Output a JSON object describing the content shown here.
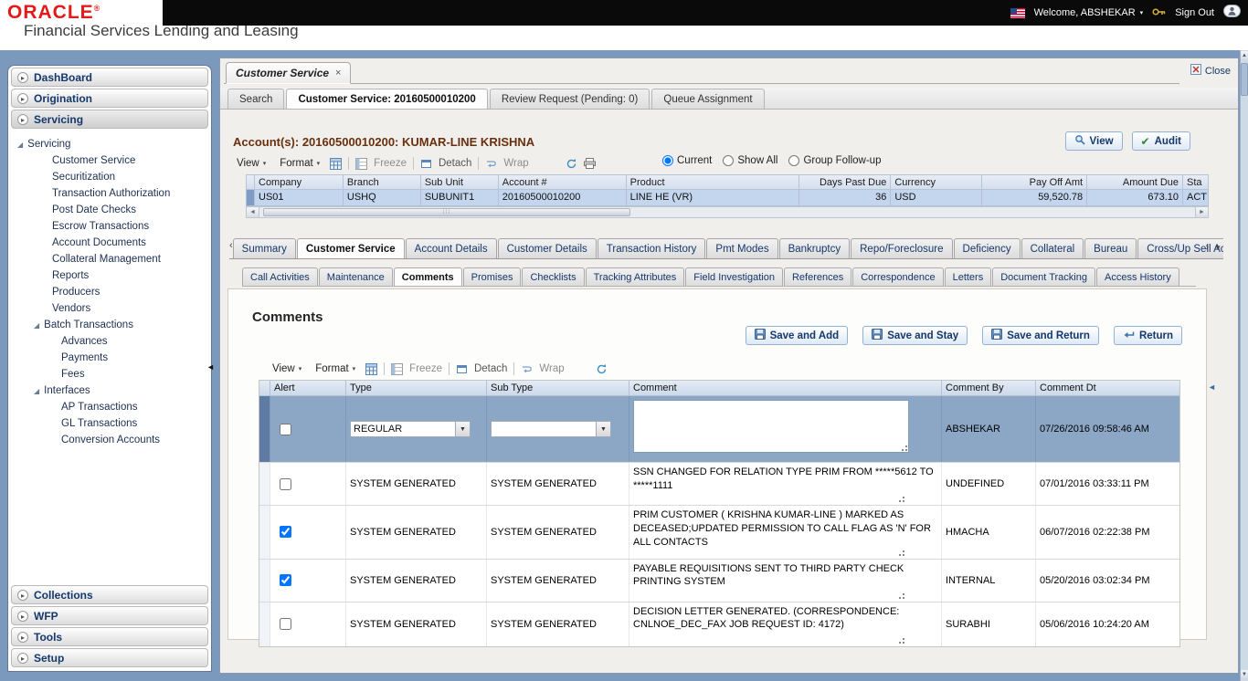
{
  "topbar": {
    "welcome": "Welcome, ABSHEKAR",
    "sign_out": "Sign Out"
  },
  "brand": {
    "logo": "ORACLE",
    "registered": "®",
    "subtitle": "Financial Services Lending and Leasing"
  },
  "sidebar": {
    "sections_top": [
      "DashBoard",
      "Origination",
      "Servicing"
    ],
    "sections_bottom": [
      "Collections",
      "WFP",
      "Tools",
      "Setup"
    ],
    "tree": {
      "root": "Servicing",
      "items": [
        "Customer Service",
        "Securitization",
        "Transaction Authorization",
        "Post Date Checks",
        "Escrow Transactions",
        "Account Documents",
        "Collateral Management",
        "Reports",
        "Producers",
        "Vendors"
      ],
      "groups": [
        {
          "label": "Batch Transactions",
          "items": [
            "Advances",
            "Payments",
            "Fees"
          ]
        },
        {
          "label": "Interfaces",
          "items": [
            "AP Transactions",
            "GL Transactions",
            "Conversion Accounts"
          ]
        }
      ]
    }
  },
  "window": {
    "doc_tab": "Customer Service",
    "close": "Close"
  },
  "nav_tabs": {
    "items": [
      "Search",
      "Customer Service: 20160500010200",
      "Review Request (Pending: 0)",
      "Queue Assignment"
    ],
    "active": "Customer Service: 20160500010200"
  },
  "account": {
    "title": "Account(s): 20160500010200: KUMAR-LINE KRISHNA",
    "buttons": {
      "view": "View",
      "audit": "Audit"
    },
    "toolbar": {
      "view": "View",
      "format": "Format",
      "freeze": "Freeze",
      "detach": "Detach",
      "wrap": "Wrap",
      "radios": [
        {
          "label": "Current",
          "checked": true
        },
        {
          "label": "Show All",
          "checked": false
        },
        {
          "label": "Group Follow-up",
          "checked": false
        }
      ]
    },
    "grid": {
      "columns": [
        "Company",
        "Branch",
        "Sub Unit",
        "Account #",
        "Product",
        "Days Past Due",
        "Currency",
        "Pay Off Amt",
        "Amount Due",
        "Sta"
      ],
      "row": {
        "company": "US01",
        "branch": "USHQ",
        "sub_unit": "SUBUNIT1",
        "account": "20160500010200",
        "product": "LINE HE (VR)",
        "days_past_due": "36",
        "currency": "USD",
        "pay_off_amt": "59,520.78",
        "amount_due": "673.10",
        "status": "ACT"
      }
    }
  },
  "section_tabs": {
    "items": [
      "Summary",
      "Customer Service",
      "Account Details",
      "Customer Details",
      "Transaction History",
      "Pmt Modes",
      "Bankruptcy",
      "Repo/Foreclosure",
      "Deficiency",
      "Collateral",
      "Bureau",
      "Cross/Up Sell Activi"
    ],
    "active": "Customer Service"
  },
  "sub_tabs": {
    "items": [
      "Call Activities",
      "Maintenance",
      "Comments",
      "Promises",
      "Checklists",
      "Tracking Attributes",
      "Field Investigation",
      "References",
      "Correspondence",
      "Letters",
      "Document Tracking",
      "Access History"
    ],
    "active": "Comments"
  },
  "comments": {
    "heading": "Comments",
    "actions": [
      "Save and Add",
      "Save and Stay",
      "Save and Return",
      "Return"
    ],
    "toolbar": {
      "view": "View",
      "format": "Format",
      "freeze": "Freeze",
      "detach": "Detach",
      "wrap": "Wrap"
    },
    "columns": [
      "Alert",
      "Type",
      "Sub Type",
      "Comment",
      "Comment By",
      "Comment Dt"
    ],
    "edit_row": {
      "alert": false,
      "type": "REGULAR",
      "sub_type": "",
      "comment": "",
      "by": "ABSHEKAR",
      "dt": "07/26/2016 09:58:46 AM"
    },
    "rows": [
      {
        "alert": false,
        "type": "SYSTEM GENERATED",
        "sub_type": "SYSTEM GENERATED",
        "comment": "SSN CHANGED FOR RELATION TYPE PRIM FROM *****5612 TO *****1111",
        "by": "UNDEFINED",
        "dt": "07/01/2016 03:33:11 PM"
      },
      {
        "alert": true,
        "type": "SYSTEM GENERATED",
        "sub_type": "SYSTEM GENERATED",
        "comment": "PRIM CUSTOMER ( KRISHNA  KUMAR-LINE )  MARKED AS DECEASED;UPDATED PERMISSION TO CALL FLAG AS 'N' FOR ALL CONTACTS",
        "by": "HMACHA",
        "dt": "06/07/2016 02:22:38 PM"
      },
      {
        "alert": true,
        "type": "SYSTEM GENERATED",
        "sub_type": "SYSTEM GENERATED",
        "comment": "PAYABLE REQUISITIONS SENT TO THIRD PARTY CHECK PRINTING SYSTEM",
        "by": "INTERNAL",
        "dt": "05/20/2016 03:02:34 PM"
      },
      {
        "alert": false,
        "type": "SYSTEM GENERATED",
        "sub_type": "SYSTEM GENERATED",
        "comment": "DECISION LETTER GENERATED. (CORRESPONDENCE: CNLNOE_DEC_FAX JOB REQUEST ID: 4172)",
        "by": "SURABHI",
        "dt": "05/06/2016 10:24:20 AM"
      }
    ]
  },
  "icons": {
    "section_chevron": "▸",
    "tree_expanded": "◢",
    "menu_caret": "▾",
    "dropdown_caret": "▼",
    "tab_close": "×",
    "scroll_left": "◄",
    "scroll_right": "►",
    "scroll_up": "▲",
    "scroll_down": "▼",
    "tab_prev": "‹",
    "tab_next": "›",
    "overflow_caret": "▼",
    "audit_check": "✔",
    "collapse_left": "◄"
  },
  "colors": {
    "oracle_red": "#e21a1a",
    "frame_blue": "#7b99bd",
    "account_title": "#68300e",
    "selected_row": "#c3d6ee",
    "edit_row": "#8ca7c6",
    "link_navy": "#15386b"
  }
}
